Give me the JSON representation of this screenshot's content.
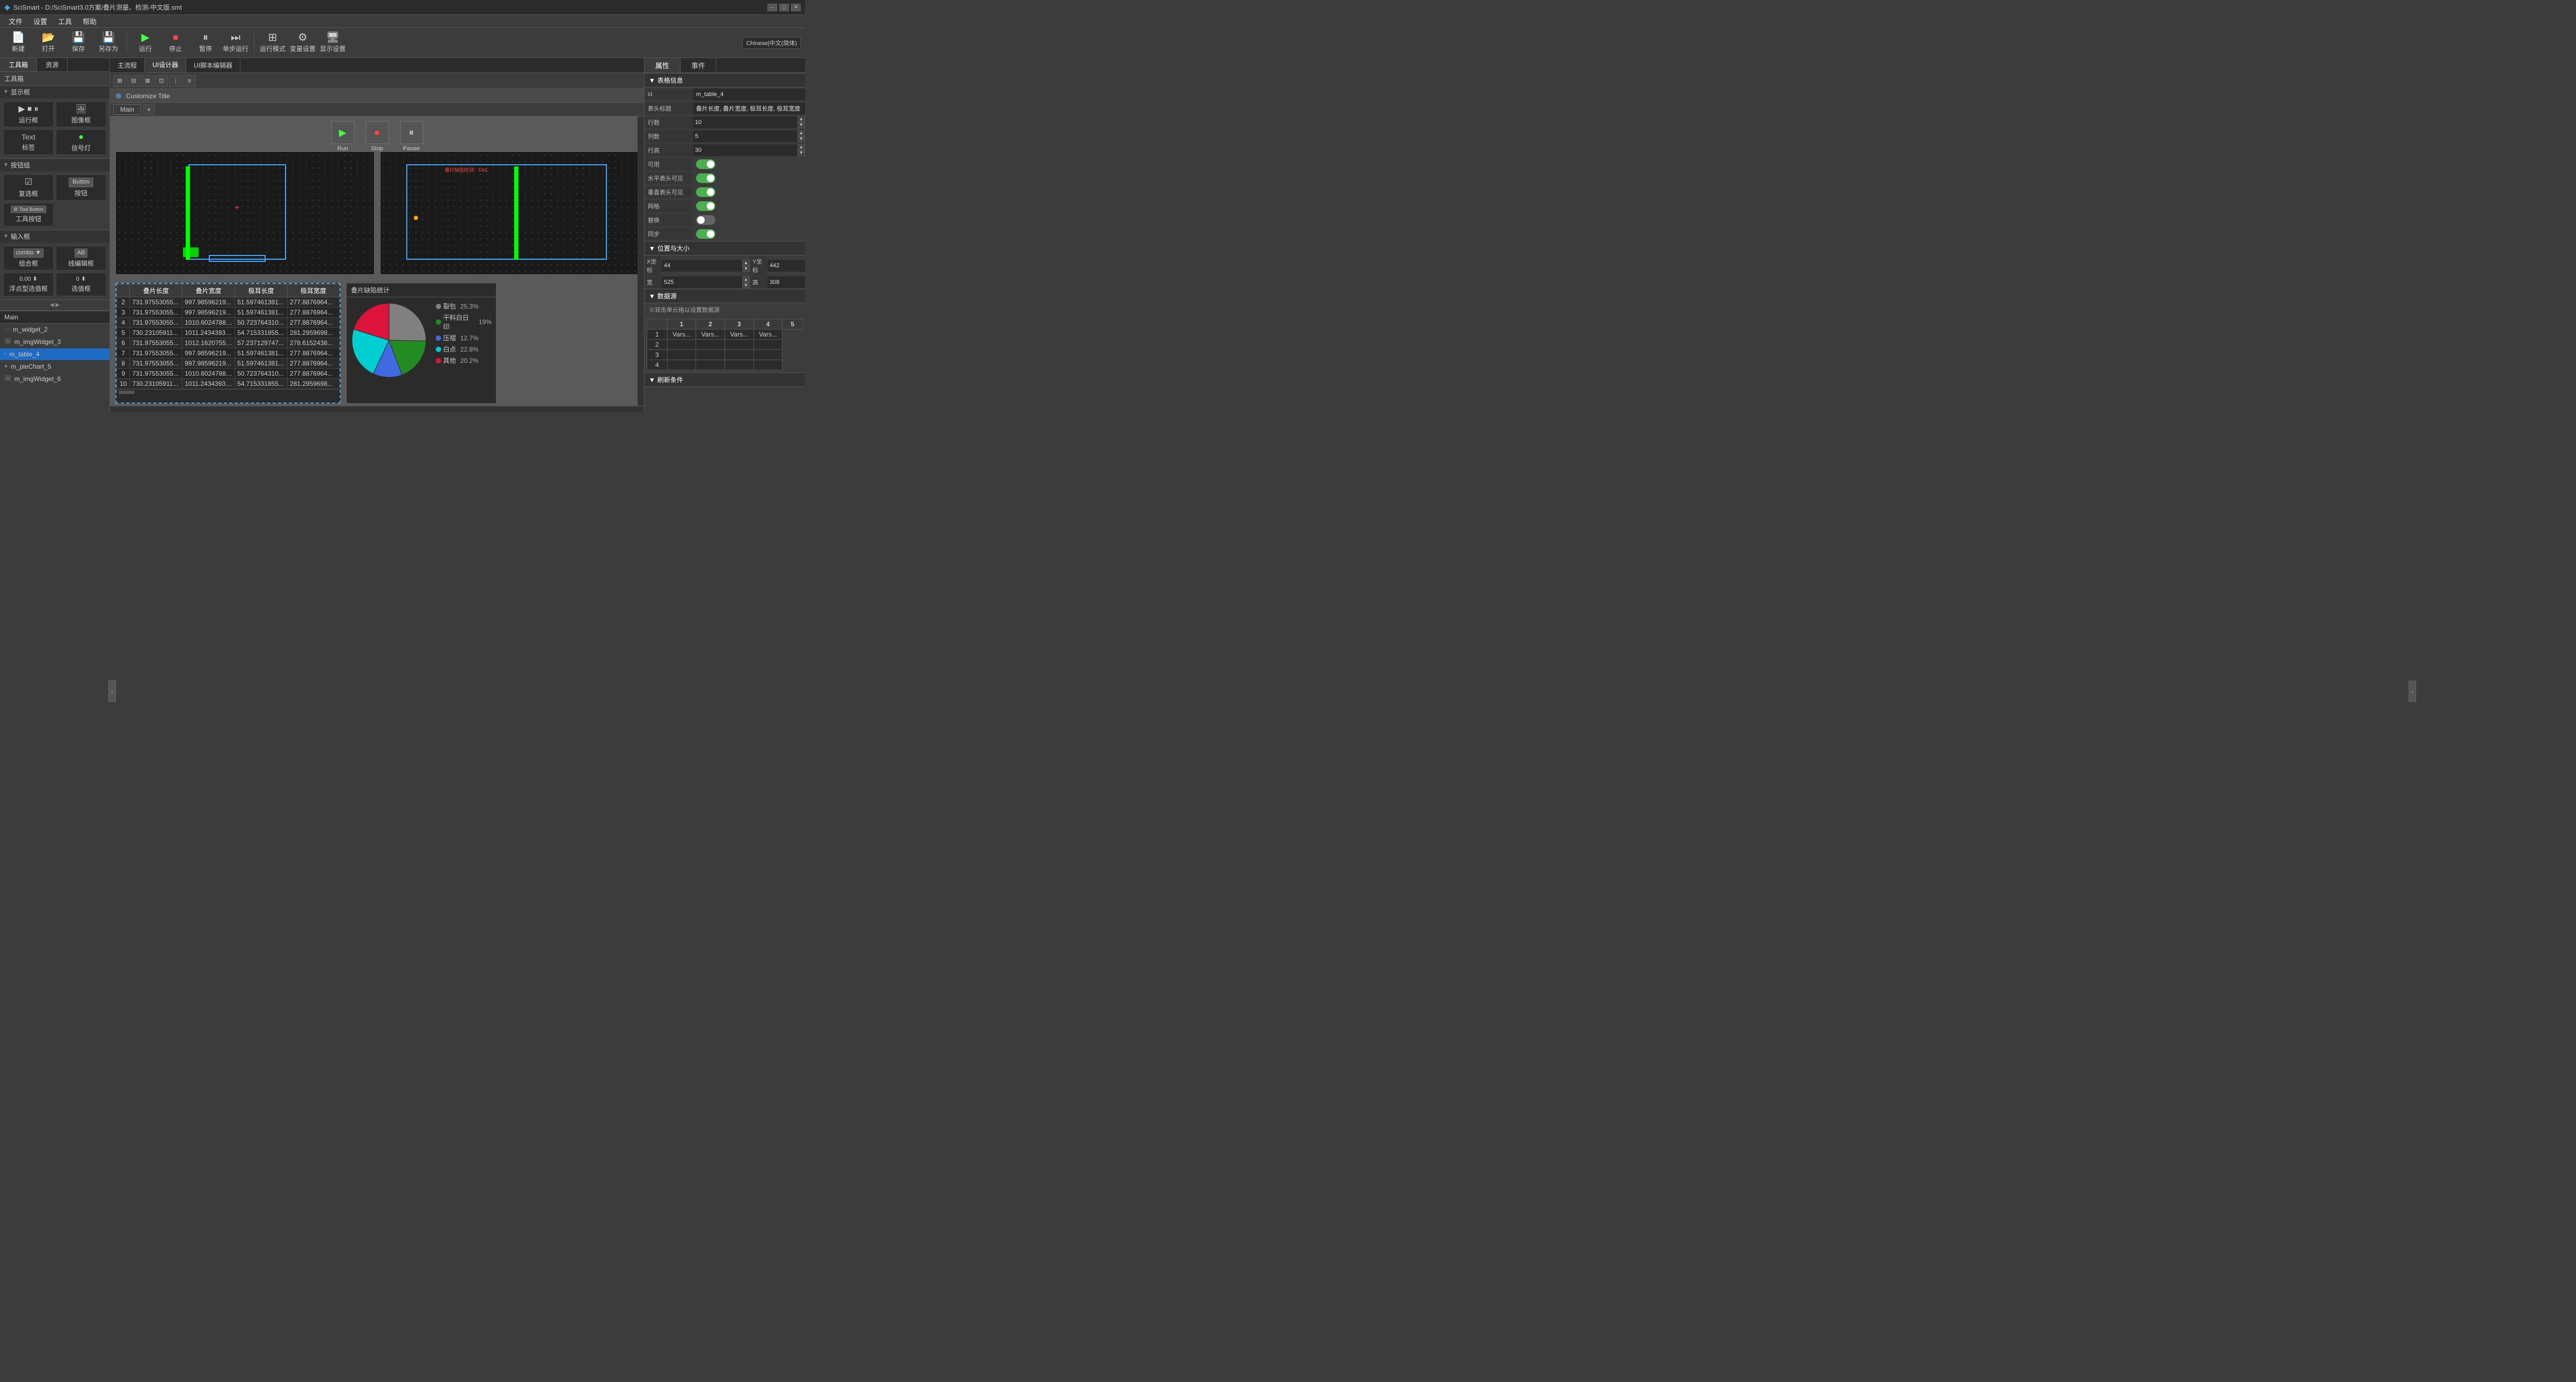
{
  "app": {
    "title": "SciSmart - D:/SciSmart3.0方案/叠片测量、检测-中文版.smt",
    "icon": "◆"
  },
  "menubar": {
    "items": [
      "文件",
      "设置",
      "工具",
      "帮助"
    ]
  },
  "toolbar": {
    "new_label": "新建",
    "open_label": "打开",
    "save_label": "保存",
    "saveas_label": "另存为",
    "run_label": "运行",
    "stop_label": "停止",
    "pause_label": "暂停",
    "step_label": "单步运行",
    "mode_label": "运行模式",
    "varset_label": "变量设置",
    "dispset_label": "显示设置",
    "lang_label": "Chinese|中文(简体)"
  },
  "left_panel": {
    "tab1": "工具箱",
    "tab2": "资源",
    "toolbox_label": "工具箱",
    "sections": [
      {
        "name": "显示框",
        "items": [
          {
            "label": "运行框",
            "icon": "▶"
          },
          {
            "label": "图像框",
            "icon": "🖼"
          },
          {
            "label": "标签",
            "icon": "T"
          },
          {
            "label": "信号灯",
            "icon": "●"
          }
        ]
      },
      {
        "name": "按钮组",
        "items": [
          {
            "label": "复选框",
            "icon": "☑"
          },
          {
            "label": "按钮",
            "icon": "⬛"
          },
          {
            "label": "工具按钮",
            "icon": "🔧"
          }
        ]
      },
      {
        "name": "输入框",
        "items": [
          {
            "label": "组合框",
            "icon": "▼"
          },
          {
            "label": "线编辑框",
            "icon": "▭"
          },
          {
            "label": "浮点型选值框",
            "icon": "0.00"
          },
          {
            "label": "选值框",
            "icon": "123"
          }
        ]
      }
    ],
    "layers_label": "Main",
    "layers": [
      {
        "name": "m_widget_2",
        "color": "#888",
        "type": "widget"
      },
      {
        "name": "m_imgWidget_3",
        "color": "#888",
        "type": "img"
      },
      {
        "name": "m_table_4",
        "color": "#1e6bc4",
        "type": "table",
        "active": true
      },
      {
        "name": "m_pieChart_5",
        "color": "#888",
        "type": "pie"
      },
      {
        "name": "m_imgWidget_6",
        "color": "#888",
        "type": "img"
      }
    ]
  },
  "center_tabs": [
    "主流程",
    "UI设计器",
    "UI脚本编辑器"
  ],
  "active_center_tab": "UI设计器",
  "canvas": {
    "customize_title": "Customize Title",
    "tab_name": "Main",
    "run_btn": "Run",
    "stop_btn": "Stop",
    "pause_btn": "Pause"
  },
  "table_data": {
    "headers": [
      "叠片长度",
      "叠片宽度",
      "极耳长度",
      "极耳宽度"
    ],
    "rows": [
      [
        "731.97553055...",
        "997.98596219...",
        "51.597461381...",
        "277.8876964..."
      ],
      [
        "731.97553055...",
        "997.98596219...",
        "51.597461381...",
        "277.8876964..."
      ],
      [
        "731.97553055...",
        "1010.60247885...",
        "50.723764310...",
        "277.8876964..."
      ],
      [
        "730.23105911...",
        "1011.24343939...",
        "54.715331855...",
        "281.2959698..."
      ],
      [
        "731.97553055...",
        "1012.16207553...",
        "57.237129747...",
        "278.6152438..."
      ],
      [
        "731.97553055...",
        "997.98596219...",
        "51.597461381...",
        "277.8876964..."
      ],
      [
        "731.97553055...",
        "997.98596219...",
        "51.597461381...",
        "277.8876964..."
      ],
      [
        "731.97553055...",
        "1010.60247885...",
        "50.723764310...",
        "277.8876964..."
      ],
      [
        "730.23105911...",
        "1011.24343939...",
        "54.715331855...",
        "281.2959698..."
      ]
    ]
  },
  "pie_chart": {
    "title": "叠片缺陷统计",
    "segments": [
      {
        "label": "裂包",
        "percent": 25.3,
        "color": "#808080",
        "start": 0,
        "end": 91
      },
      {
        "label": "干料白日印",
        "percent": 19.0,
        "color": "#228B22",
        "start": 91,
        "end": 159
      },
      {
        "label": "压褶",
        "percent": 12.7,
        "color": "#4169E1",
        "start": 159,
        "end": 205
      },
      {
        "label": "白点",
        "percent": 22.8,
        "color": "#00CED1",
        "start": 205,
        "end": 287
      },
      {
        "label": "其他",
        "percent": 20.2,
        "color": "#DC143C",
        "start": 287,
        "end": 360
      }
    ]
  },
  "right_panel": {
    "tab1": "属性",
    "tab2": "事件",
    "sections": {
      "table_info": "表格信息",
      "position_size": "位置与大小",
      "datasource": "数据源"
    },
    "props": {
      "id_label": "id",
      "id_value": "m_table_4",
      "header_label": "表头标题",
      "header_value": "叠片长度, 叠片宽度, 极耳长度, 极耳宽度",
      "rows_label": "行数",
      "rows_value": "10",
      "cols_label": "列数",
      "cols_value": "5",
      "rowheight_label": "行高",
      "rowheight_value": "30",
      "enabled_label": "可用",
      "h_header_label": "水平表头可见",
      "v_header_label": "垂直表头可见",
      "grid_label": "网格",
      "replace_label": "替换",
      "sync_label": "同步",
      "x_label": "X坐标",
      "x_value": "44",
      "y_label": "Y坐标",
      "y_value": "442",
      "w_label": "宽",
      "w_value": "525",
      "h_label": "高",
      "h_value": "308",
      "ds_hint": "※双击单元格以设置数据源"
    },
    "datasource_cols": [
      "1",
      "2",
      "3",
      "4",
      "5"
    ],
    "datasource_rows": [
      [
        "1",
        "Vars...",
        "Vars...",
        "Vars...",
        "Vars..."
      ],
      [
        "2",
        "",
        "",
        "",
        ""
      ],
      [
        "3",
        "",
        "",
        "",
        ""
      ],
      [
        "4",
        "",
        "",
        "",
        ""
      ]
    ]
  }
}
